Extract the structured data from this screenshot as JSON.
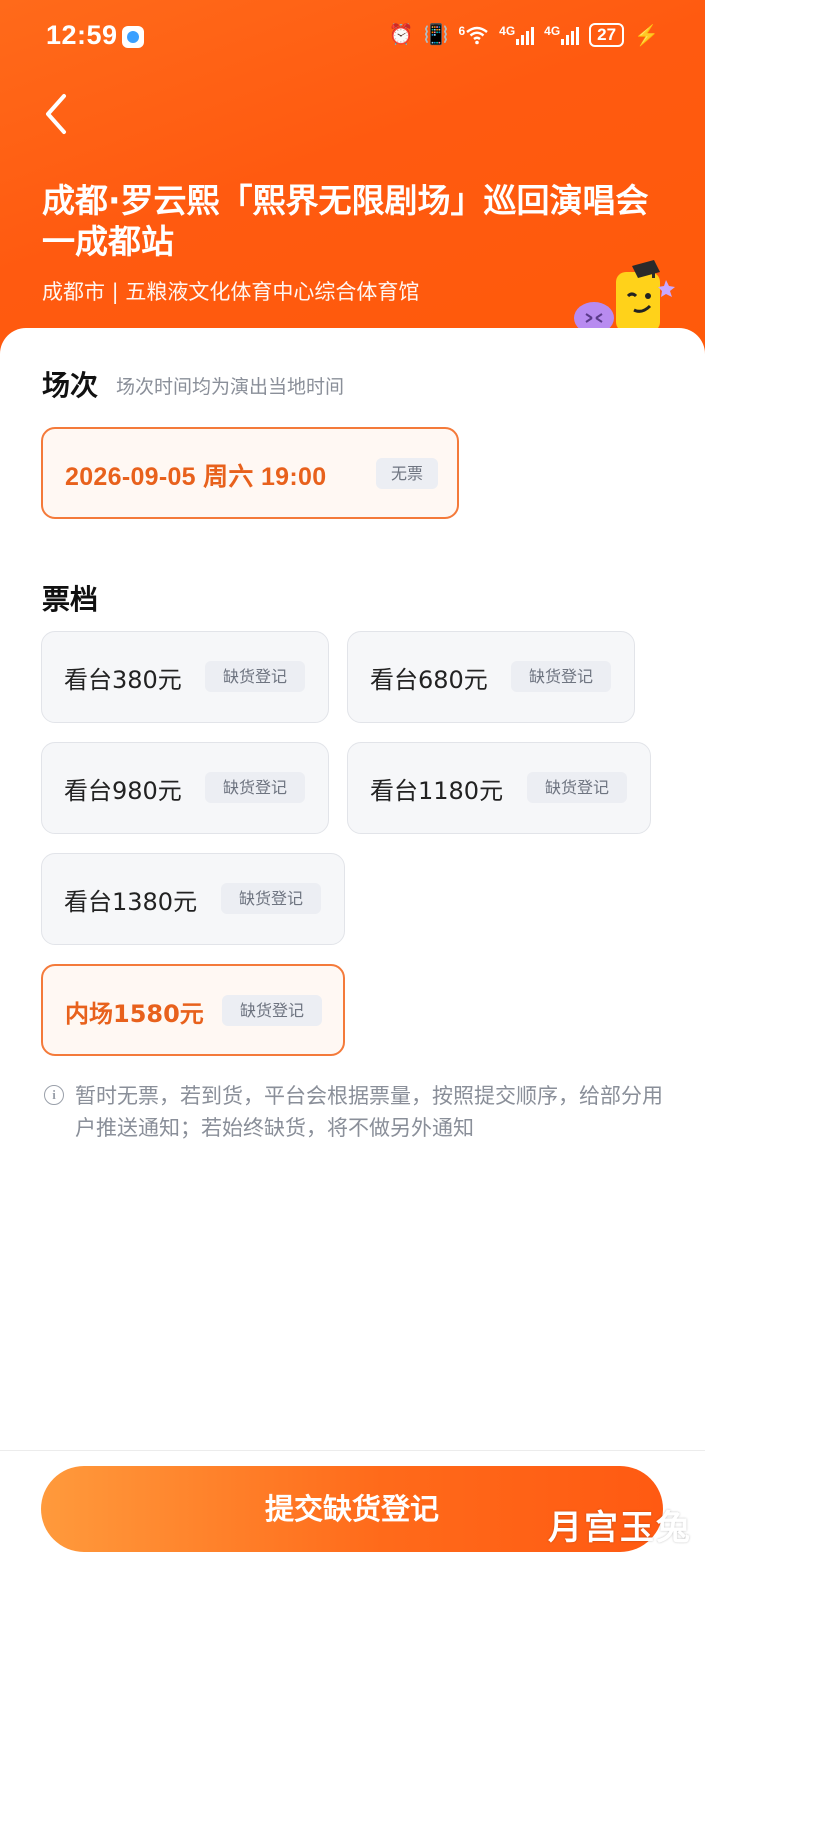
{
  "status_bar": {
    "time": "12:59",
    "net1": "4G",
    "net2": "4G",
    "wifi_label": "6",
    "battery": "27"
  },
  "header": {
    "title": "成都·罗云熙「熙界无限剧场」巡回演唱会一成都站",
    "subtitle": "成都市 | 五粮液文化体育中心综合体育馆"
  },
  "session": {
    "section_title": "场次",
    "note": "场次时间均为演出当地时间",
    "date": "2026-09-05  周六 19:00",
    "badge": "无票"
  },
  "tiers": {
    "section_title": "票档",
    "items": [
      {
        "label": "看台380元",
        "badge": "缺货登记",
        "selected": false
      },
      {
        "label": "看台680元",
        "badge": "缺货登记",
        "selected": false
      },
      {
        "label": "看台980元",
        "badge": "缺货登记",
        "selected": false
      },
      {
        "label": "看台1180元",
        "badge": "缺货登记",
        "selected": false
      },
      {
        "label": "看台1380元",
        "badge": "缺货登记",
        "selected": false
      },
      {
        "label": "内场1580元",
        "badge": "缺货登记",
        "selected": true
      }
    ]
  },
  "info": {
    "text": "暂时无票，若到货，平台会根据票量，按照提交顺序，给部分用户推送通知；若始终缺货，将不做另外通知"
  },
  "footer": {
    "submit_label": "提交缺货登记"
  },
  "watermark": "月宫玉兔",
  "colors": {
    "brand_orange": "#ff5a10",
    "accent_text": "#e8611c",
    "selected_border": "#f47a3a"
  }
}
